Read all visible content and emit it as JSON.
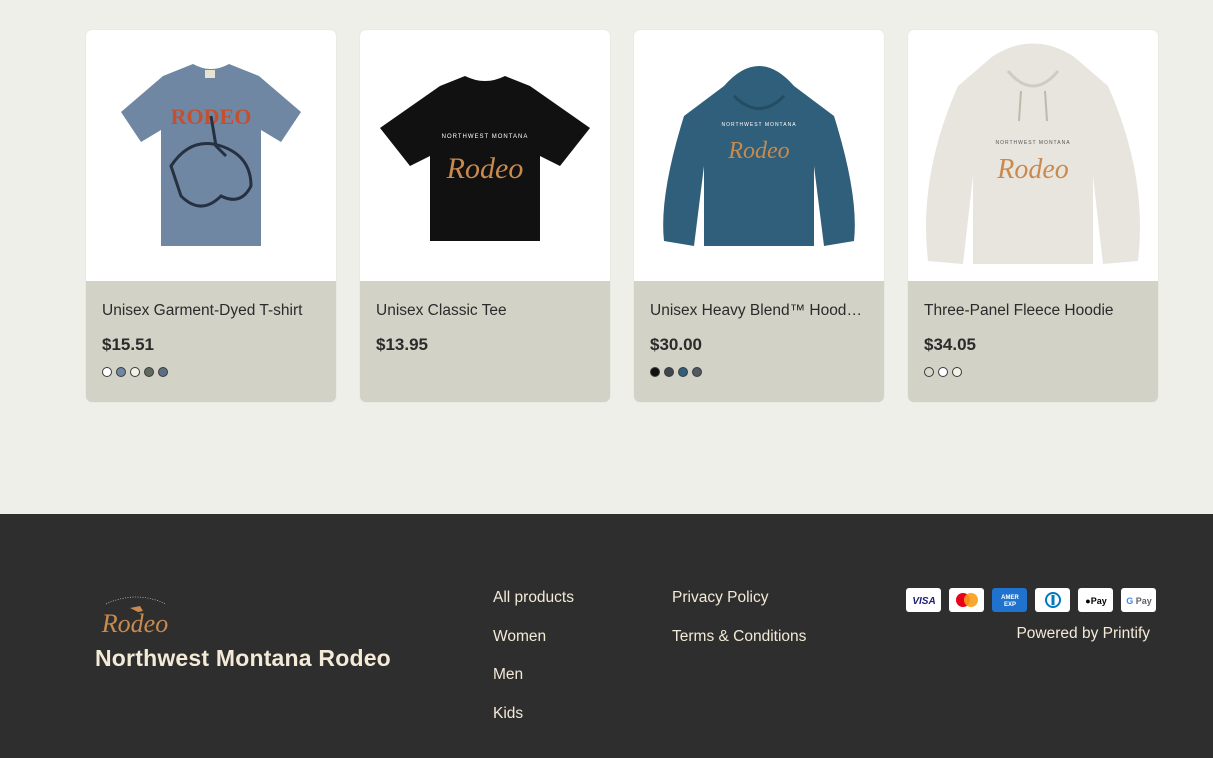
{
  "products": [
    {
      "title": "Unisex Garment-Dyed T-shirt",
      "price": "$15.51",
      "swatches": [
        "#ffffff",
        "#6f87a3",
        "#f4f1e6",
        "#5f6b5e",
        "#5c6f82"
      ],
      "image": "rodeo-bronc-tshirt"
    },
    {
      "title": "Unisex Classic Tee",
      "price": "$13.95",
      "swatches": [],
      "image": "black-rodeo-tee"
    },
    {
      "title": "Unisex Heavy Blend™ Hooded Sweatshirt",
      "price": "$30.00",
      "swatches": [
        "#111111",
        "#3e4650",
        "#2f5f7a",
        "#505a60"
      ],
      "image": "teal-rodeo-hoodie"
    },
    {
      "title": "Three-Panel Fleece Hoodie",
      "price": "$34.05",
      "swatches": [
        "#d9d8d0",
        "#ffffff",
        "#f4f1e6"
      ],
      "image": "oatmeal-rodeo-hoodie"
    }
  ],
  "footer": {
    "logo_text": "Rodeo",
    "brand_name": "Northwest Montana Rodeo",
    "nav": [
      "All products",
      "Women",
      "Men",
      "Kids"
    ],
    "legal": [
      "Privacy Policy",
      "Terms & Conditions"
    ],
    "payments": [
      "Visa",
      "Mastercard",
      "American Express",
      "Diners Club",
      "Apple Pay",
      "Google Pay"
    ],
    "powered": "Powered by Printify"
  },
  "colors": {
    "footer_bg": "#2e2e2e",
    "card_bg": "#d2d2c7",
    "page_bg": "#efefea",
    "brand_text": "#f3ead7",
    "logo_orange": "#c98a4e"
  }
}
